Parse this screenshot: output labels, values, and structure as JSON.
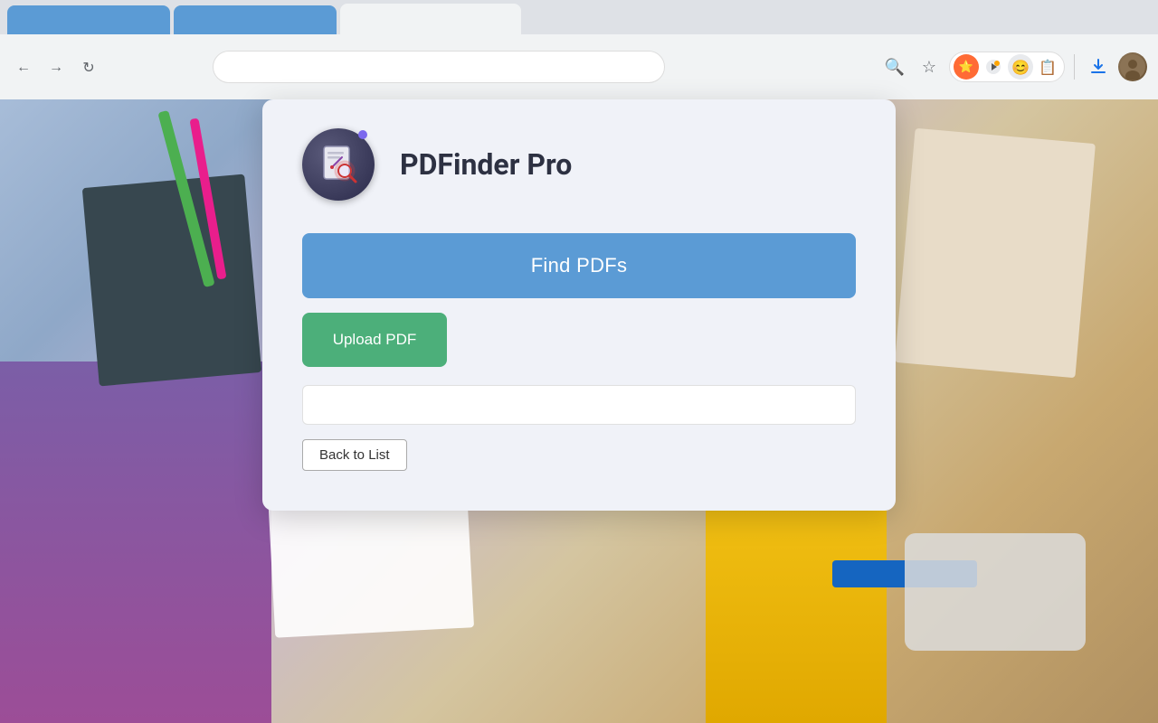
{
  "app": {
    "title": "PDFinder Pro",
    "icon_label": "pdf-finder-icon"
  },
  "buttons": {
    "find_pdfs": "Find PDFs",
    "upload_pdf": "Upload PDF",
    "back_to_list": "Back to List"
  },
  "input": {
    "placeholder": "",
    "value": ""
  },
  "browser": {
    "zoom_icon": "🔍",
    "bookmark_icon": "☆",
    "ext1_icon": "⭐",
    "ext2_icon": "▶",
    "ext3_icon": "😊",
    "ext4_icon": "📋",
    "download_icon": "⬇",
    "colors": {
      "tab_active_bg": "#f1f3f4",
      "tab_inactive_bg": "#5b9bd5",
      "find_pdfs_bg": "#5b9bd5",
      "upload_pdf_bg": "#4caf7a"
    }
  }
}
